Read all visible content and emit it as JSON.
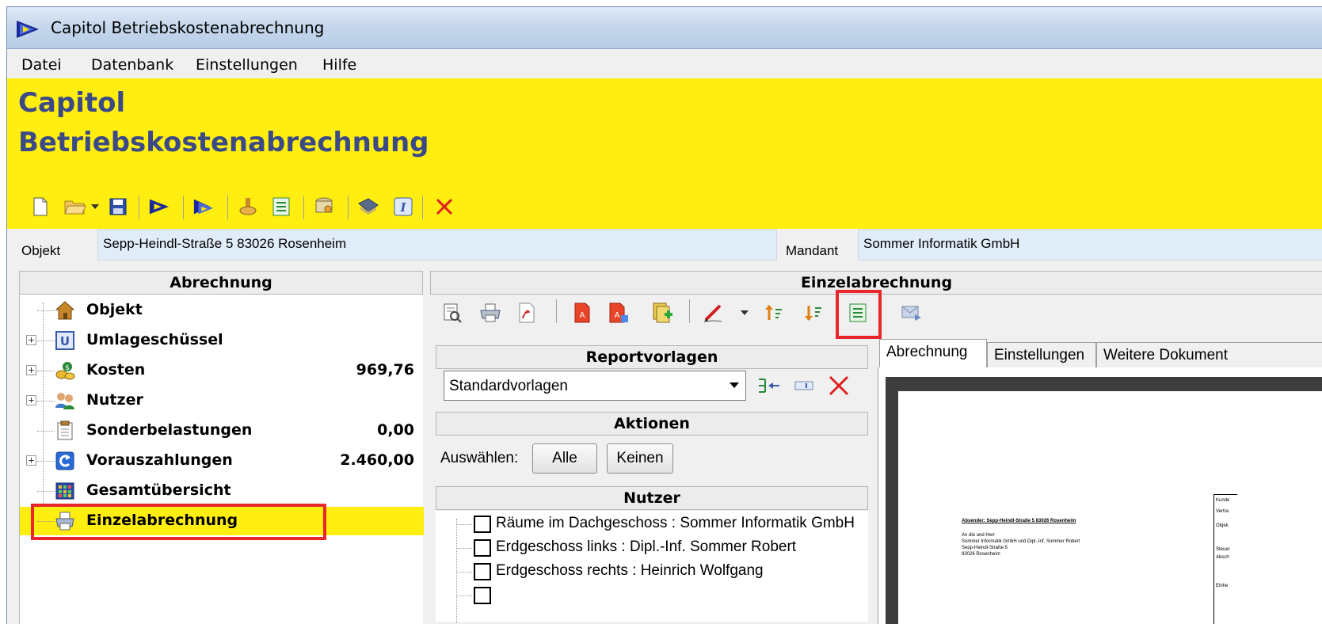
{
  "window": {
    "title": "Capitol Betriebskostenabrechnung"
  },
  "menu": {
    "items": [
      "Datei",
      "Datenbank",
      "Einstellungen",
      "Hilfe"
    ]
  },
  "banner": {
    "line1": "Capitol",
    "line2": "Betriebskostenabrechnung",
    "bg_color": "#ffee10",
    "text_color": "#3b4a86"
  },
  "toolbar": {
    "icons": [
      "new-document-icon",
      "open-folder-icon",
      "dropdown-arrow-icon",
      "save-icon",
      "play-arrow-icon",
      "play-multi-icon",
      "stamp-icon",
      "list-report-icon",
      "key-database-icon",
      "bookmark-icon",
      "info-icon",
      "delete-icon"
    ]
  },
  "object_bar": {
    "objekt_label": "Objekt",
    "objekt_value": "Sepp-Heindl-Straße 5  83026 Rosenheim",
    "mandant_label": "Mandant",
    "mandant_value": "Sommer Informatik GmbH"
  },
  "left_panel": {
    "header": "Abrechnung",
    "items": [
      {
        "label": "Objekt",
        "value": "",
        "icon": "house-icon"
      },
      {
        "label": "Umlageschüssel",
        "value": "",
        "icon": "key-u-icon"
      },
      {
        "label": "Kosten",
        "value": "969,76",
        "icon": "coins-icon"
      },
      {
        "label": "Nutzer",
        "value": "",
        "icon": "users-icon"
      },
      {
        "label": "Sonderbelastungen",
        "value": "0,00",
        "icon": "clipboard-icon"
      },
      {
        "label": "Vorauszahlungen",
        "value": "2.460,00",
        "icon": "payment-arrow-icon"
      },
      {
        "label": "Gesamtübersicht",
        "value": "",
        "icon": "grid-icon"
      },
      {
        "label": "Einzelabrechnung",
        "value": "",
        "icon": "printer-icon"
      }
    ]
  },
  "right_panel": {
    "header": "Einzelabrechnung",
    "report_header": "Reportvorlagen",
    "report_selected": "Standardvorlagen",
    "actions_header": "Aktionen",
    "select_label": "Auswählen:",
    "btn_all": "Alle",
    "btn_none": "Keinen",
    "users_header": "Nutzer",
    "users": [
      "Räume im Dachgeschoss : Sommer Informatik GmbH",
      "Erdgeschoss links : Dipl.-Inf. Sommer Robert",
      "Erdgeschoss rechts : Heinrich Wolfgang"
    ],
    "tabs": [
      "Abrechnung",
      "Einstellungen",
      "Weitere Dokument"
    ]
  },
  "preview": {
    "sender_line": "Absender: Sepp-Heindl-Straße 5 83026 Rosenheim",
    "address": [
      "An die und Herr",
      "Sommer Informatik GmbH und Dipl.-Inf. Sommer Robert",
      "Sepp-Heindl-Straße 5",
      "83026 Rosenheim"
    ],
    "side_labels": [
      "Kunde",
      "Vertra",
      "Objek",
      "Steuer",
      "Absch",
      "Einhe"
    ]
  }
}
